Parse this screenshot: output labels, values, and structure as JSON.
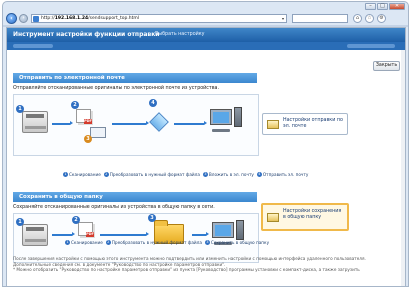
{
  "browser": {
    "url_prefix": "http://",
    "url_host": "192.168.1.24",
    "url_path": "/sendsupport_top.html",
    "window_buttons": [
      "–",
      "□",
      "✕"
    ],
    "nav_back": "‹",
    "nav_forward": "›"
  },
  "header": {
    "title": "Инструмент настройки функции отправки",
    "link": "Выбрать настройку"
  },
  "close_button": "Закрыть",
  "email_section": {
    "title": "Отправить по электронной почте",
    "description": "Отправляйте отсканированные оригиналы по электронной почте из устройства.",
    "steps": [
      {
        "num": "1",
        "label": "Сканирование"
      },
      {
        "num": "2",
        "label": "Преобразовать в нужный формат файла"
      },
      {
        "num": "3",
        "label": "Вложить в эл. почту"
      },
      {
        "num": "4",
        "label": "Отправить эл. почту"
      }
    ],
    "action": "Настройки отправки по эл. почте",
    "diagram_numbers": [
      "1",
      "2",
      "3",
      "4"
    ],
    "pdf_badge": "PDF"
  },
  "folder_section": {
    "title": "Сохранить в общую папку",
    "description": "Сохраняйте отсканированные оригиналы из устройства в общую папку в сети.",
    "steps": [
      {
        "num": "1",
        "label": "Сканирование"
      },
      {
        "num": "2",
        "label": "Преобразовать в нужный формат файла"
      },
      {
        "num": "3",
        "label": "Сохранить в общую папку"
      }
    ],
    "action": "Настройки сохранения в общую папку",
    "diagram_numbers": [
      "1",
      "2",
      "3"
    ],
    "pdf_badge": "PDF"
  },
  "footer": {
    "line1": "После завершения настройки с помощью этого инструмента можно подтвердить или изменить настройки с помощью интерфейса удаленного пользователя.",
    "line2": "Дополнительные сведения см. в документе \"Руководство по настройке параметров отправки\".",
    "line3": "* Можно отобразить \"Руководство по настройке параметров отправки\" из пункта [Руководство] программы установки с компакт-диска, а также загрузить"
  },
  "colors": {
    "header_bg": "#2a6db7",
    "section_bg": "#3b87cf",
    "flow_arrow": "#2f7bd0",
    "active_border": "#f0b94a"
  }
}
